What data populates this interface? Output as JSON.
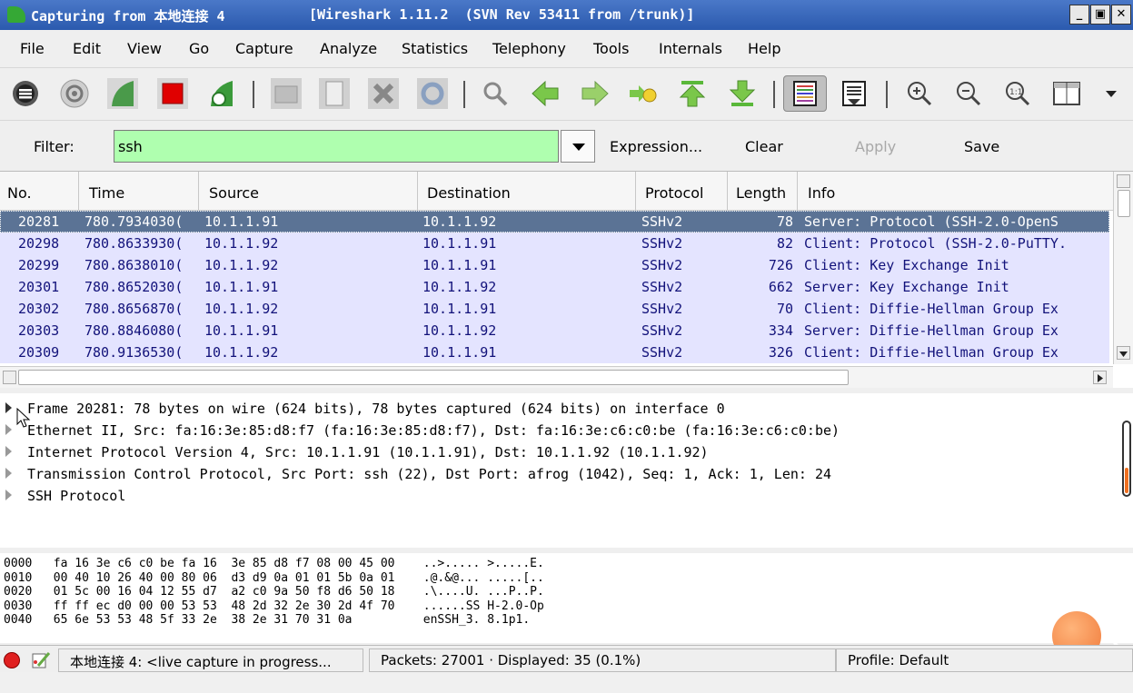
{
  "window": {
    "title_left": "Capturing from 本地连接 4",
    "title_right": "[Wireshark 1.11.2  (SVN Rev 53411 from /trunk)]",
    "btn_min": "_",
    "btn_max": "Ɖ",
    "btn_close": "✕"
  },
  "menu": [
    "File",
    "Edit",
    "View",
    "Go",
    "Capture",
    "Analyze",
    "Statistics",
    "Telephony",
    "Tools",
    "Internals",
    "Help"
  ],
  "filter": {
    "label": "Filter:",
    "value": "ssh",
    "expression": "Expression...",
    "clear": "Clear",
    "apply": "Apply",
    "save": "Save"
  },
  "columns": [
    "No.",
    "Time",
    "Source",
    "Destination",
    "Protocol",
    "Length",
    "Info"
  ],
  "packets": [
    {
      "no": "20281",
      "time": "780.7934030(",
      "src": "10.1.1.91",
      "dst": "10.1.1.92",
      "proto": "SSHv2",
      "len": "78",
      "info": "Server: Protocol (SSH-2.0-OpenS"
    },
    {
      "no": "20298",
      "time": "780.8633930(",
      "src": "10.1.1.92",
      "dst": "10.1.1.91",
      "proto": "SSHv2",
      "len": "82",
      "info": "Client: Protocol (SSH-2.0-PuTTY."
    },
    {
      "no": "20299",
      "time": "780.8638010(",
      "src": "10.1.1.92",
      "dst": "10.1.1.91",
      "proto": "SSHv2",
      "len": "726",
      "info": "Client: Key Exchange Init"
    },
    {
      "no": "20301",
      "time": "780.8652030(",
      "src": "10.1.1.91",
      "dst": "10.1.1.92",
      "proto": "SSHv2",
      "len": "662",
      "info": "Server: Key Exchange Init"
    },
    {
      "no": "20302",
      "time": "780.8656870(",
      "src": "10.1.1.92",
      "dst": "10.1.1.91",
      "proto": "SSHv2",
      "len": "70",
      "info": "Client: Diffie-Hellman Group Ex"
    },
    {
      "no": "20303",
      "time": "780.8846080(",
      "src": "10.1.1.91",
      "dst": "10.1.1.92",
      "proto": "SSHv2",
      "len": "334",
      "info": "Server: Diffie-Hellman Group Ex"
    },
    {
      "no": "20309",
      "time": "780.9136530(",
      "src": "10.1.1.92",
      "dst": "10.1.1.91",
      "proto": "SSHv2",
      "len": "326",
      "info": "Client: Diffie-Hellman Group Ex"
    }
  ],
  "details": [
    "Frame 20281: 78 bytes on wire (624 bits), 78 bytes captured (624 bits) on interface 0",
    "Ethernet II, Src: fa:16:3e:85:d8:f7 (fa:16:3e:85:d8:f7), Dst: fa:16:3e:c6:c0:be (fa:16:3e:c6:c0:be)",
    "Internet Protocol Version 4, Src: 10.1.1.91 (10.1.1.91), Dst: 10.1.1.92 (10.1.1.92)",
    "Transmission Control Protocol, Src Port: ssh (22), Dst Port: afrog (1042), Seq: 1, Ack: 1, Len: 24",
    "SSH Protocol"
  ],
  "hex": [
    "0000   fa 16 3e c6 c0 be fa 16  3e 85 d8 f7 08 00 45 00    ..>..... >.....E.",
    "0010   00 40 10 26 40 00 80 06  d3 d9 0a 01 01 5b 0a 01    .@.&@... .....[..",
    "0020   01 5c 00 16 04 12 55 d7  a2 c0 9a 50 f8 d6 50 18    .\\....U. ...P..P.",
    "0030   ff ff ec d0 00 00 53 53  48 2d 32 2e 30 2d 4f 70    ......SS H-2.0-Op",
    "0040   65 6e 53 53 48 5f 33 2e  38 2e 31 70 31 0a          enSSH_3. 8.1p1."
  ],
  "status": {
    "capture": "本地连接 4: <live capture in progress...",
    "packets": "Packets: 27001 · Displayed: 35 (0.1%)",
    "profile": "Profile: Default"
  },
  "colors": {
    "selected_row": "#5b7395",
    "ssh_row": "#e4e4ff",
    "filter_ok": "#afffaf",
    "title_bar": "#2b5aae"
  }
}
